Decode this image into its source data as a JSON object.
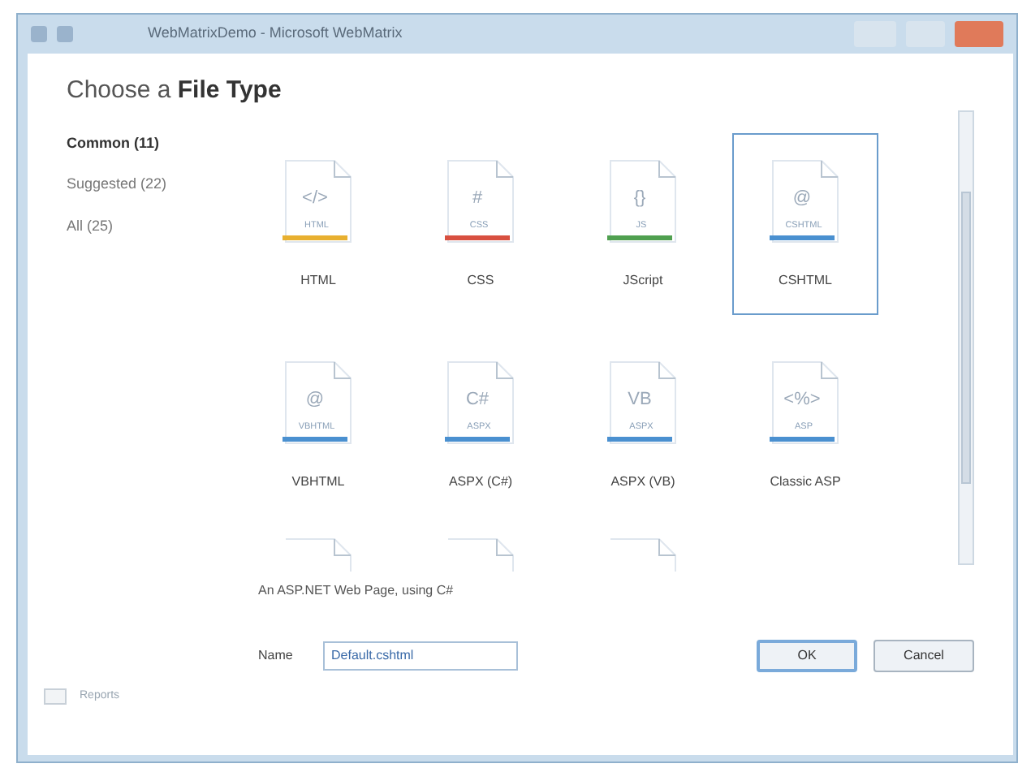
{
  "window": {
    "title": "WebMatrixDemo - Microsoft WebMatrix"
  },
  "dialog": {
    "heading_plain": "Choose a ",
    "heading_bold": "File Type"
  },
  "categories": [
    {
      "label": "Common (11)",
      "selected": true
    },
    {
      "label": "Suggested (22)",
      "selected": false
    },
    {
      "label": "All (25)",
      "selected": false
    }
  ],
  "file_types": [
    {
      "label": "HTML",
      "badge": "HTML",
      "glyph": "</>",
      "color": "#e8b030",
      "selected": false
    },
    {
      "label": "CSS",
      "badge": "CSS",
      "glyph": "#",
      "color": "#d85040",
      "selected": false
    },
    {
      "label": "JScript",
      "badge": "JS",
      "glyph": "{}",
      "color": "#50a050",
      "selected": false
    },
    {
      "label": "CSHTML",
      "badge": "CSHTML",
      "glyph": "@",
      "color": "#4a90d0",
      "selected": true
    },
    {
      "label": "VBHTML",
      "badge": "VBHTML",
      "glyph": "@",
      "color": "#4a90d0",
      "selected": false
    },
    {
      "label": "ASPX (C#)",
      "badge": "ASPX",
      "glyph": "C#",
      "color": "#4a90d0",
      "selected": false
    },
    {
      "label": "ASPX (VB)",
      "badge": "ASPX",
      "glyph": "VB",
      "color": "#4a90d0",
      "selected": false
    },
    {
      "label": "Classic ASP",
      "badge": "ASP",
      "glyph": "<%>",
      "color": "#4a90d0",
      "selected": false
    }
  ],
  "partial_row": [
    {
      "kind": "file"
    },
    {
      "kind": "file"
    },
    {
      "kind": "file"
    }
  ],
  "description": "An ASP.NET Web Page, using C#",
  "name_field": {
    "label": "Name",
    "value": "Default.cshtml"
  },
  "buttons": [
    {
      "label": "OK",
      "kind": "default"
    },
    {
      "label": "Cancel",
      "kind": "normal"
    }
  ],
  "workspace": {
    "label": "Reports"
  }
}
